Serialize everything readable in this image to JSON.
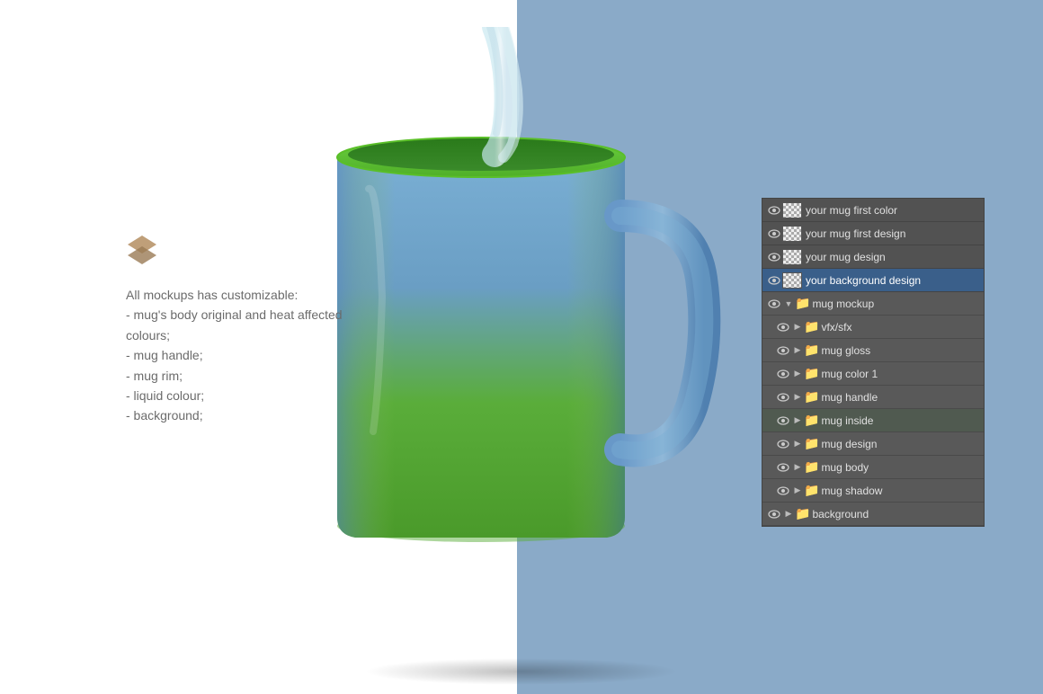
{
  "background": {
    "left_color": "#ffffff",
    "right_color": "#8aaac8"
  },
  "left_panel": {
    "icon_alt": "layers icon",
    "description": "All mockups has customizable:\n- mug's body original and heat affected colours;\n- mug handle;\n- mug rim;\n- liquid colour;\n- background;"
  },
  "layers_panel": {
    "top_rows": [
      {
        "id": "row-mug-first-color",
        "thumb_type": "checker",
        "name": "your mug first color",
        "highlighted": true
      },
      {
        "id": "row-mug-first-design",
        "thumb_type": "checker",
        "name": "your mug first design",
        "highlighted": true
      },
      {
        "id": "row-mug-design",
        "thumb_type": "checker",
        "name": "your mug design",
        "highlighted": true
      },
      {
        "id": "row-background-design",
        "thumb_type": "checker",
        "name": "your background design",
        "highlighted": true
      }
    ],
    "tree_rows": [
      {
        "id": "row-mug-mockup",
        "indent": 0,
        "has_eye": true,
        "has_arrow": true,
        "has_arrow_down": true,
        "is_folder": true,
        "name": "mug mockup"
      },
      {
        "id": "row-vfx-sfx",
        "indent": 1,
        "has_eye": true,
        "has_arrow": true,
        "has_arrow_down": false,
        "is_folder": true,
        "name": "vfx/sfx"
      },
      {
        "id": "row-mug-gloss",
        "indent": 1,
        "has_eye": true,
        "has_arrow": true,
        "has_arrow_down": false,
        "is_folder": true,
        "name": "mug gloss"
      },
      {
        "id": "row-mug-color-1",
        "indent": 1,
        "has_eye": true,
        "has_arrow": true,
        "has_arrow_down": false,
        "is_folder": true,
        "name": "mug color 1"
      },
      {
        "id": "row-mug-handle",
        "indent": 1,
        "has_eye": true,
        "has_arrow": true,
        "has_arrow_down": false,
        "is_folder": true,
        "name": "mug handle"
      },
      {
        "id": "row-mug-inside",
        "indent": 1,
        "has_eye": true,
        "has_arrow": true,
        "has_arrow_down": false,
        "is_folder": true,
        "name": "mug inside"
      },
      {
        "id": "row-mug-design",
        "indent": 1,
        "has_eye": true,
        "has_arrow": true,
        "has_arrow_down": false,
        "is_folder": true,
        "name": "mug design"
      },
      {
        "id": "row-mug-body",
        "indent": 1,
        "has_eye": true,
        "has_arrow": true,
        "has_arrow_down": false,
        "is_folder": true,
        "name": "mug body"
      },
      {
        "id": "row-mug-shadow",
        "indent": 1,
        "has_eye": true,
        "has_arrow": true,
        "has_arrow_down": false,
        "is_folder": true,
        "name": "mug shadow"
      },
      {
        "id": "row-background",
        "indent": 0,
        "has_eye": true,
        "has_arrow": true,
        "has_arrow_down": false,
        "is_folder": true,
        "name": "background"
      }
    ]
  }
}
